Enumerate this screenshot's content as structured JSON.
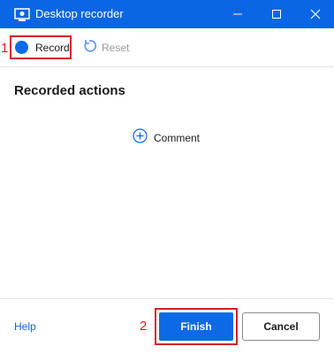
{
  "window": {
    "title": "Desktop recorder",
    "accent": "#0a66e4",
    "controls": [
      "minimize-icon",
      "maximize-icon",
      "close-icon"
    ]
  },
  "toolbar": {
    "record_label": "Record",
    "reset_label": "Reset"
  },
  "annotations": {
    "marker_1": "1",
    "marker_2": "2",
    "color": "#e0181f"
  },
  "main": {
    "section_title": "Recorded actions",
    "comment_label": "Comment"
  },
  "footer": {
    "help_label": "Help",
    "finish_label": "Finish",
    "cancel_label": "Cancel"
  }
}
